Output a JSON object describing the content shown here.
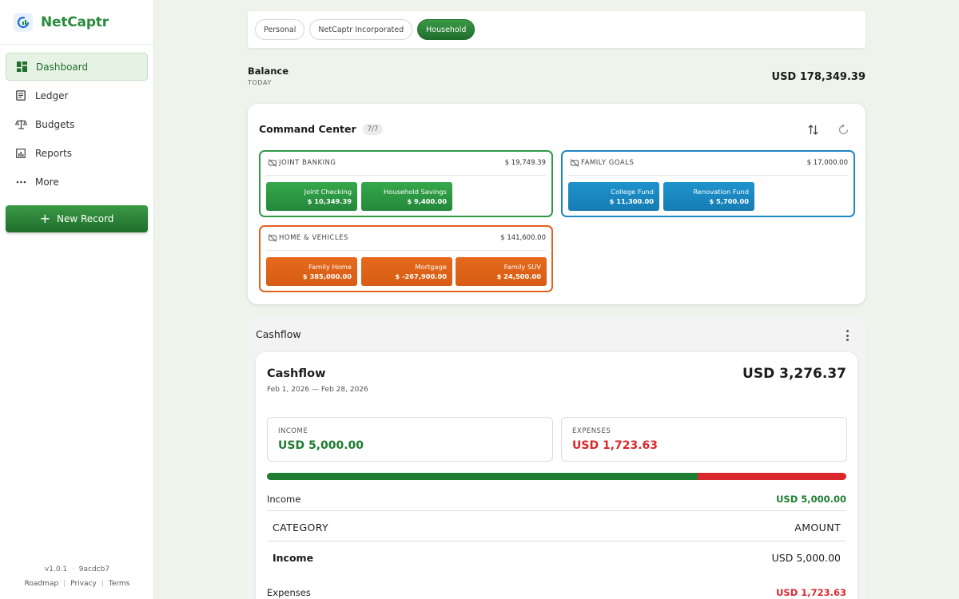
{
  "brand": {
    "name": "NetCaptr"
  },
  "nav": [
    {
      "label": "Dashboard",
      "icon": "dashboard-icon",
      "active": true
    },
    {
      "label": "Ledger",
      "icon": "ledger-icon"
    },
    {
      "label": "Budgets",
      "icon": "scale-icon"
    },
    {
      "label": "Reports",
      "icon": "chart-icon"
    },
    {
      "label": "More",
      "icon": "more-dots-icon"
    }
  ],
  "new_record": "New Record",
  "footer": {
    "version": "v1.0.1",
    "sep": "·",
    "hash": "9acdcb7",
    "links": [
      "Roadmap",
      "Privacy",
      "Terms"
    ]
  },
  "tabs": [
    {
      "label": "Personal",
      "active": false
    },
    {
      "label": "NetCaptr Incorporated",
      "active": false
    },
    {
      "label": "Household",
      "active": true
    }
  ],
  "balance": {
    "label": "Balance",
    "sub": "TODAY",
    "value": "USD 178,349.39"
  },
  "command_center": {
    "title": "Command Center",
    "count": "7/7",
    "groups": [
      {
        "name": "JOINT BANKING",
        "total": "$ 19,749.39",
        "color": "#2f9a46",
        "accounts": [
          {
            "name": "Joint Checking",
            "amount": "$ 10,349.39"
          },
          {
            "name": "Household Savings",
            "amount": "$ 9,400.00"
          }
        ]
      },
      {
        "name": "FAMILY GOALS",
        "total": "$ 17,000.00",
        "color": "#1f86c4",
        "accounts": [
          {
            "name": "College Fund",
            "amount": "$ 11,300.00"
          },
          {
            "name": "Renovation Fund",
            "amount": "$ 5,700.00"
          }
        ]
      },
      {
        "name": "HOME & VEHICLES",
        "total": "$ 141,600.00",
        "color": "#e0631f",
        "accounts": [
          {
            "name": "Family Home",
            "amount": "$ 385,000.00"
          },
          {
            "name": "Mortgage",
            "amount": "$ -267,900.00"
          },
          {
            "name": "Family SUV",
            "amount": "$ 24,500.00"
          }
        ]
      }
    ]
  },
  "cashflow": {
    "section_title": "Cashflow",
    "title": "Cashflow",
    "range": "Feb 1, 2026 — Feb 28, 2026",
    "total": "USD 3,276.37",
    "income_label": "INCOME",
    "income_value": "USD 5,000.00",
    "expenses_label": "EXPENSES",
    "expenses_value": "USD 1,723.63",
    "income_share": 0.7436,
    "income_row": {
      "label": "Income",
      "value": "USD 5,000.00"
    },
    "table": {
      "col1": "CATEGORY",
      "col2": "AMOUNT",
      "rows": [
        {
          "name": "Income",
          "amount": "USD 5,000.00"
        }
      ]
    },
    "expenses_row": {
      "label": "Expenses",
      "value": "USD 1,723.63"
    }
  },
  "colors": {
    "green": "#1f7d32",
    "red": "#d9292d",
    "brand": "#2b8a3e"
  }
}
